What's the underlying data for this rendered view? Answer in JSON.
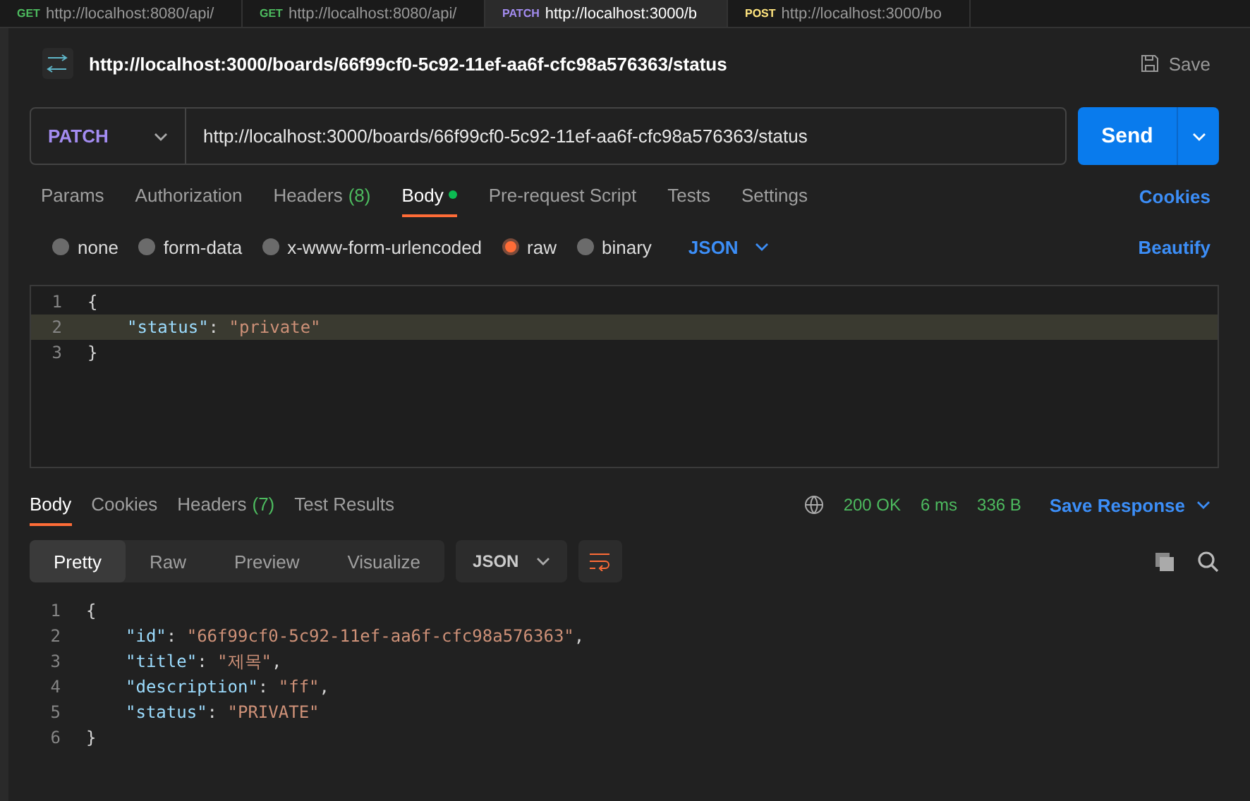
{
  "open_tabs": [
    {
      "method": "GET",
      "url": "http://localhost:8080/api/",
      "selected": false
    },
    {
      "method": "GET",
      "url": "http://localhost:8080/api/",
      "selected": false
    },
    {
      "method": "PATCH",
      "url": "http://localhost:3000/b",
      "selected": true
    },
    {
      "method": "POST",
      "url": "http://localhost:3000/bo",
      "selected": false
    }
  ],
  "request": {
    "title": "http://localhost:3000/boards/66f99cf0-5c92-11ef-aa6f-cfc98a576363/status",
    "save": "Save",
    "method": "PATCH",
    "url": "http://localhost:3000/boards/66f99cf0-5c92-11ef-aa6f-cfc98a576363/status",
    "send": "Send"
  },
  "request_tabs": [
    {
      "label": "Params",
      "selected": false
    },
    {
      "label": "Authorization",
      "selected": false
    },
    {
      "label": "Headers",
      "count": "(8)",
      "selected": false
    },
    {
      "label": "Body",
      "dot": true,
      "selected": true
    },
    {
      "label": "Pre-request Script",
      "selected": false
    },
    {
      "label": "Tests",
      "selected": false
    },
    {
      "label": "Settings",
      "selected": false
    }
  ],
  "cookies_link": "Cookies",
  "body_types": [
    {
      "label": "none",
      "selected": false
    },
    {
      "label": "form-data",
      "selected": false
    },
    {
      "label": "x-www-form-urlencoded",
      "selected": false
    },
    {
      "label": "raw",
      "selected": true
    },
    {
      "label": "binary",
      "selected": false
    }
  ],
  "body_format": "JSON",
  "beautify": "Beautify",
  "request_body": [
    {
      "number": "1",
      "tokens": [
        {
          "kind": "punct",
          "text": "{"
        }
      ]
    },
    {
      "number": "2",
      "highlighted": true,
      "tokens": [
        {
          "kind": "key",
          "text": "\"status\""
        },
        {
          "kind": "punct",
          "text": ": "
        },
        {
          "kind": "string",
          "text": "\"private\""
        }
      ]
    },
    {
      "number": "3",
      "tokens": [
        {
          "kind": "punct",
          "text": "}"
        }
      ]
    }
  ],
  "response_tabs": [
    {
      "label": "Body",
      "selected": true
    },
    {
      "label": "Cookies",
      "selected": false
    },
    {
      "label": "Headers",
      "count": "(7)",
      "selected": false
    },
    {
      "label": "Test Results",
      "selected": false
    }
  ],
  "response_status": {
    "status": "200 OK",
    "time": "6 ms",
    "size": "336 B",
    "save": "Save Response"
  },
  "view_modes": [
    {
      "label": "Pretty",
      "selected": true
    },
    {
      "label": "Raw",
      "selected": false
    },
    {
      "label": "Preview",
      "selected": false
    },
    {
      "label": "Visualize",
      "selected": false
    }
  ],
  "response_format": "JSON",
  "response_body": [
    {
      "number": "1",
      "tokens": [
        {
          "kind": "punct",
          "text": "{"
        }
      ]
    },
    {
      "number": "2",
      "tokens": [
        {
          "kind": "key",
          "text": "\"id\""
        },
        {
          "kind": "punct",
          "text": ": "
        },
        {
          "kind": "string",
          "text": "\"66f99cf0-5c92-11ef-aa6f-cfc98a576363\""
        },
        {
          "kind": "punct",
          "text": ","
        }
      ]
    },
    {
      "number": "3",
      "tokens": [
        {
          "kind": "key",
          "text": "\"title\""
        },
        {
          "kind": "punct",
          "text": ": "
        },
        {
          "kind": "string",
          "text": "\"제목\""
        },
        {
          "kind": "punct",
          "text": ","
        }
      ]
    },
    {
      "number": "4",
      "tokens": [
        {
          "kind": "key",
          "text": "\"description\""
        },
        {
          "kind": "punct",
          "text": ": "
        },
        {
          "kind": "string",
          "text": "\"ff\""
        },
        {
          "kind": "punct",
          "text": ","
        }
      ]
    },
    {
      "number": "5",
      "tokens": [
        {
          "kind": "key",
          "text": "\"status\""
        },
        {
          "kind": "punct",
          "text": ": "
        },
        {
          "kind": "string",
          "text": "\"PRIVATE\""
        }
      ]
    },
    {
      "number": "6",
      "tokens": [
        {
          "kind": "punct",
          "text": "}"
        }
      ]
    }
  ]
}
